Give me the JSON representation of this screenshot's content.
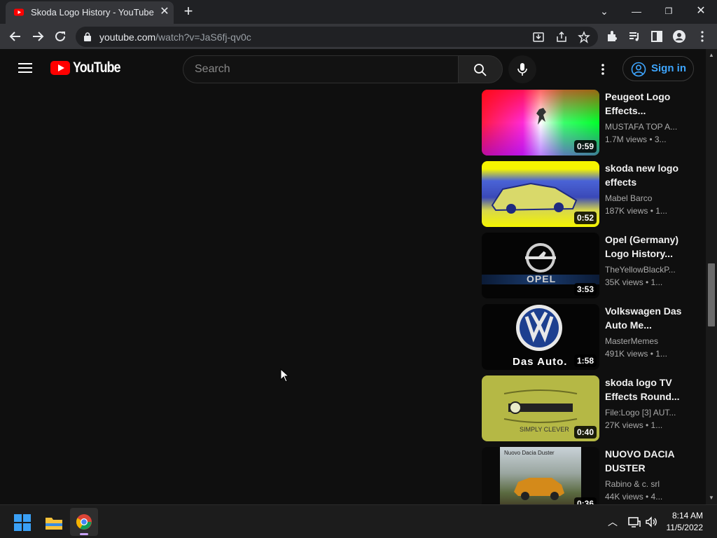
{
  "browser": {
    "tab_title": "Skoda Logo History - YouTube",
    "url_host": "youtube.com",
    "url_path": "/watch?v=JaS6fj-qv0c"
  },
  "header": {
    "logo_text": "YouTube",
    "search_placeholder": "Search",
    "signin_label": "Sign in"
  },
  "related_videos": [
    {
      "title": "Peugeot Logo Effects...",
      "channel": "MUSTAFA TOP A...",
      "meta": "1.7M views  • 3...",
      "duration": "0:59"
    },
    {
      "title": "skoda new logo effects",
      "channel": "Mabel Barco",
      "meta": "187K views  • 1...",
      "duration": "0:52"
    },
    {
      "title": "Opel (Germany) Logo History...",
      "channel": "TheYellowBlackP...",
      "meta": "35K views  • 1...",
      "duration": "3:53"
    },
    {
      "title": "Volkswagen Das Auto Me...",
      "channel": "MasterMemes",
      "meta": "491K views  • 1...",
      "duration": "1:58"
    },
    {
      "title": "skoda logo TV Effects Round...",
      "channel": "File:Logo [3] AUT...",
      "meta": "27K views  • 1...",
      "duration": "0:40"
    },
    {
      "title": "NUOVO DACIA DUSTER",
      "channel": "Rabino & c. srl",
      "meta": "44K views  • 4...",
      "duration": "0:36"
    }
  ],
  "thumb_text": {
    "vw_caption": "Das Auto.",
    "opel_caption": "OPEL",
    "skoda_caption": "SIMPLY CLEVER",
    "dacia_caption": "Nuovo Dacia Duster"
  },
  "taskbar": {
    "time": "8:14 AM",
    "date": "11/5/2022"
  },
  "colors": {
    "background": "#0f0f0f",
    "accent_blue": "#3ea6ff",
    "yt_red": "#ff0000"
  }
}
